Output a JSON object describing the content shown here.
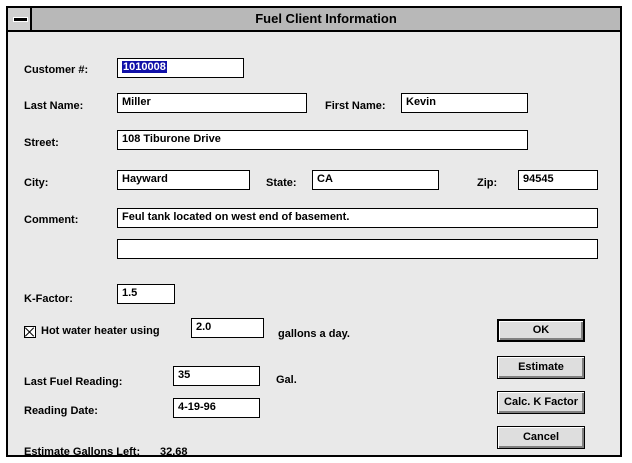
{
  "window": {
    "title": "Fuel Client Information"
  },
  "form": {
    "customer_label": "Customer #:",
    "customer_value": "1010008",
    "last_name_label": "Last Name:",
    "last_name_value": "Miller",
    "first_name_label": "First Name:",
    "first_name_value": "Kevin",
    "street_label": "Street:",
    "street_value": "108 Tiburone Drive",
    "city_label": "City:",
    "city_value": "Hayward",
    "state_label": "State:",
    "state_value": "CA",
    "zip_label": "Zip:",
    "zip_value": "94545",
    "comment_label": "Comment:",
    "comment_line1": "Feul tank located on west end of basement.",
    "comment_line2": "",
    "kfactor_label": "K-Factor:",
    "kfactor_value": "1.5",
    "hot_water_label": "Hot water heater using",
    "hot_water_checked": true,
    "hot_water_value": "2.0",
    "gallons_day_label": "gallons a day.",
    "last_reading_label": "Last Fuel Reading:",
    "last_reading_value": "35",
    "gal_label": "Gal.",
    "reading_date_label": "Reading Date:",
    "reading_date_value": "4-19-96",
    "estimate_label": "Estimate Gallons Left:",
    "estimate_value": "32.68"
  },
  "buttons": {
    "ok": "OK",
    "estimate": "Estimate",
    "calc_k": "Calc. K Factor",
    "cancel": "Cancel"
  },
  "icons": {
    "system_menu": "system-menu-icon",
    "checkbox": "checkbox-checked-icon"
  }
}
